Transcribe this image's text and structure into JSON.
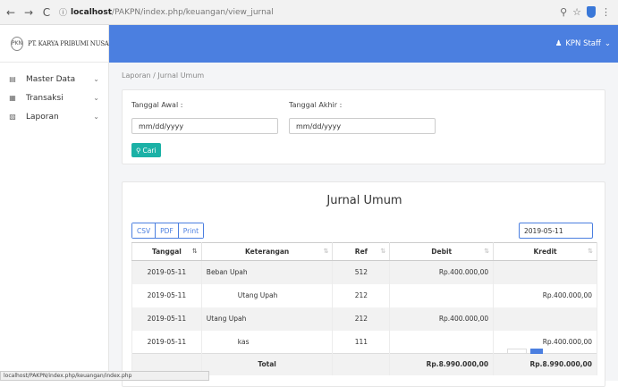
{
  "browser": {
    "back": "←",
    "forward": "→",
    "reload": "C",
    "info": "ⓘ",
    "url_host": "localhost",
    "url_path": "/PAKPN/index.php/keuangan/view_jurnal"
  },
  "brand": {
    "logo": "PKN",
    "name": "PT. KARYA PRIBUMI NUSANTARA"
  },
  "sidebar": {
    "items": [
      {
        "label": "Master Data",
        "icon": "▤"
      },
      {
        "label": "Transaksi",
        "icon": "▦"
      },
      {
        "label": "Laporan",
        "icon": "▨"
      }
    ]
  },
  "topbar": {
    "user": "KPN Staff"
  },
  "breadcrumb": "Laporan / Jurnal Umum",
  "filter": {
    "start_label": "Tanggal Awal :",
    "start_placeholder": "mm/dd/yyyy",
    "end_label": "Tanggal Akhir :",
    "end_placeholder": "mm/dd/yyyy",
    "search_button": "Cari"
  },
  "table_card": {
    "title": "Jurnal Umum",
    "export": [
      "CSV",
      "PDF",
      "Print"
    ],
    "search_value": "2019-05-11",
    "columns": [
      "Tanggal",
      "Keterangan",
      "Ref",
      "Debit",
      "Kredit"
    ],
    "rows": [
      {
        "tanggal": "2019-05-11",
        "keterangan": "Beban Upah",
        "ref": "512",
        "debit": "Rp.400.000,00",
        "kredit": ""
      },
      {
        "tanggal": "2019-05-11",
        "keterangan": "Utang Upah",
        "ref": "212",
        "debit": "",
        "kredit": "Rp.400.000,00"
      },
      {
        "tanggal": "2019-05-11",
        "keterangan": "Utang Upah",
        "ref": "212",
        "debit": "Rp.400.000,00",
        "kredit": ""
      },
      {
        "tanggal": "2019-05-11",
        "keterangan": "kas",
        "ref": "111",
        "debit": "",
        "kredit": "Rp.400.000,00"
      }
    ],
    "total_label": "Total",
    "total_debit": "Rp.8.990.000,00",
    "total_kredit": "Rp.8.990.000,00"
  },
  "status_bar": "localhost/PAKPN/index.php/keuangan/index.php",
  "colors": {
    "primary": "#4b7fe0",
    "teal": "#1bb1a6"
  }
}
